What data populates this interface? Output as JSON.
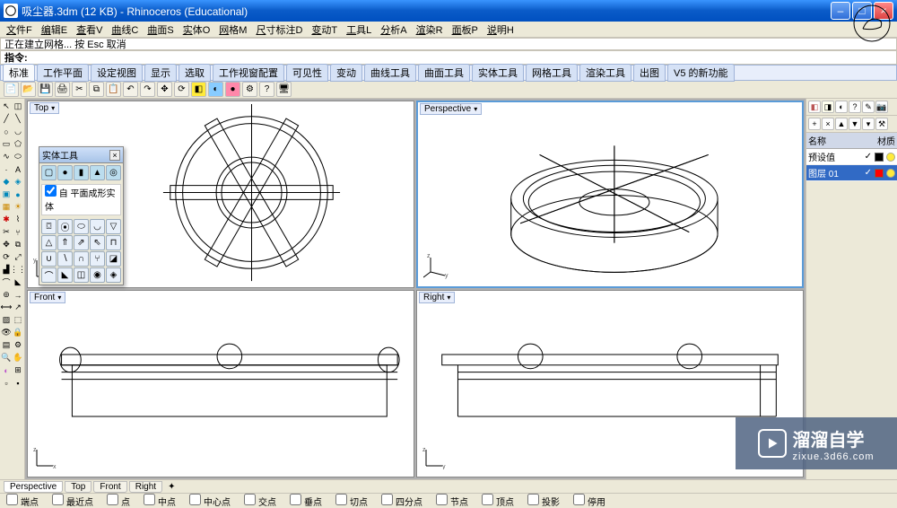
{
  "title": "吸尘器.3dm (12 KB) - Rhinoceros (Educational)",
  "menu": [
    "文件F",
    "编辑E",
    "查看V",
    "曲线C",
    "曲面S",
    "实体O",
    "网格M",
    "尺寸标注D",
    "变动T",
    "工具L",
    "分析A",
    "渲染R",
    "面板P",
    "说明H"
  ],
  "cmd_history": "正在建立网格... 按 Esc 取消",
  "cmd_prompt": "指令:",
  "tabs": [
    "标准",
    "工作平面",
    "设定视图",
    "显示",
    "选取",
    "工作视窗配置",
    "可见性",
    "变动",
    "曲线工具",
    "曲面工具",
    "实体工具",
    "网格工具",
    "渲染工具",
    "出图",
    "V5 的新功能"
  ],
  "active_tab": "标准",
  "viewports": {
    "top": "Top",
    "perspective": "Perspective",
    "front": "Front",
    "right": "Right"
  },
  "float_toolbox": {
    "title": "实体工具",
    "checkbox": "自 平面成形实体"
  },
  "right_panel": {
    "col_name": "名称",
    "col_mat": "材质",
    "rows": [
      {
        "name": "预设值",
        "selected": false,
        "color": "#000"
      },
      {
        "name": "图层 01",
        "selected": true,
        "color": "#f00"
      }
    ]
  },
  "bottom_tabs": [
    "Perspective",
    "Top",
    "Front",
    "Right"
  ],
  "active_bottom_tab": "Perspective",
  "status_items": [
    "端点",
    "最近点",
    "点",
    "中点",
    "中心点",
    "交点",
    "垂点",
    "切点",
    "四分点",
    "节点",
    "顶点",
    "投影",
    "停用"
  ],
  "watermark": {
    "main": "溜溜自学",
    "sub": "zixue.3d66.com"
  }
}
